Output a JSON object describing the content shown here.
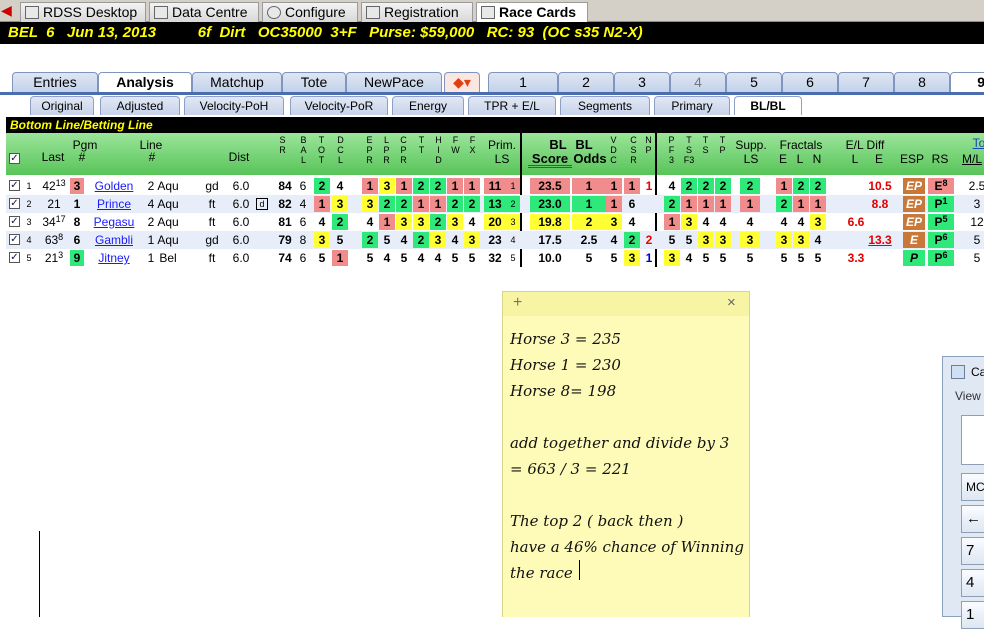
{
  "top_tabs": [
    {
      "label": "RDSS Desktop",
      "icon": "desktop-icon"
    },
    {
      "label": "Data Centre",
      "icon": "data-icon"
    },
    {
      "label": "Configure",
      "icon": "gear-icon"
    },
    {
      "label": "Registration",
      "icon": "registration-icon"
    },
    {
      "label": "Race Cards",
      "icon": "race-card-icon"
    }
  ],
  "race_info": "BEL  6   Jun 13, 2013          6f  Dirt   OC35000  3+F   Purse: $59,000   RC: 93  (OC s35 N2-X)",
  "nav_tabs": [
    "Entries",
    "Analysis",
    "Matchup",
    "Tote",
    "NewPace"
  ],
  "race_numbers": [
    "1",
    "2",
    "3",
    "4",
    "5",
    "6",
    "7",
    "8",
    "9"
  ],
  "sub_tabs": [
    "Original",
    "Adjusted",
    "Velocity-PoH",
    "Velocity-PoR",
    "Energy",
    "TPR + E/L",
    "Segments",
    "Primary",
    "BL/BL"
  ],
  "section_title": "Bottom Line/Betting Line",
  "headers": {
    "last": "Last",
    "pgm": "Pgm",
    "pgm_hash": "#",
    "line": "Line",
    "line_hash": "#",
    "dist": "Dist",
    "sr": "S\nR",
    "bal": "B\nA\nL",
    "tot": "T\nO\nT",
    "dcl": "D\nC\nL",
    "epr": "E\nP\nR",
    "lpr": "L\nP\nR",
    "cpr": "C\nP\nR",
    "tt": "T\nT",
    "hid": "H\nI\nD",
    "fw": "F\nW",
    "fx": "F\nX",
    "prim": "Prim.",
    "ls": "LS",
    "bl": "BL",
    "bl2": "BL",
    "score": "Score",
    "odds": "Odds",
    "vdc": "V\nD\nC",
    "csr": "C\nS\nR",
    "np": "N\nP",
    "pf3": "P\nF\n3",
    "tf3": "T\nS\nF3",
    "ts": "T\nS",
    "tp": "T\nP",
    "supp": "Supp.",
    "supp_ls": "LS",
    "fractals": "Fractals",
    "fe": "E",
    "fl": "L",
    "fn": "N",
    "eldiff": "E/L Diff",
    "el_l": "L",
    "el_e": "E",
    "esp": "ESP",
    "rs": "RS",
    "ml": "M/L",
    "to": "To"
  },
  "rows": [
    {
      "n": "1",
      "last": "42",
      "last_sup": "13",
      "pgm": "3",
      "name": "Golden",
      "line": "2",
      "trk": "Aqu",
      "cond": "gd",
      "dist": "6.0",
      "dflag": "",
      "sr": "84",
      "bal": "6",
      "tot": "2",
      "dcl": "4",
      "epr": "1",
      "lpr": "3",
      "cpr": "1",
      "tt": "2",
      "hid": "2",
      "fw": "1",
      "fx": "1",
      "prim": "11",
      "prim_rank": "1",
      "bl": "23.5",
      "blrank": "1",
      "odds": "",
      "vdc": "1",
      "csr": "1",
      "np": "1",
      "pf3": "4",
      "tf3": "2",
      "ts": "2",
      "tp": "2",
      "supp": "2",
      "fe": "1",
      "fl": "2",
      "fn": "2",
      "el_l": "",
      "el_e": "10.5",
      "esp": "EP",
      "rs": "E",
      "rs_sup": "8",
      "ml": "2.5"
    },
    {
      "n": "2",
      "last": "21",
      "last_sup": "",
      "pgm": "1",
      "name": "Prince",
      "line": "4",
      "trk": "Aqu",
      "cond": "ft",
      "dist": "6.0",
      "dflag": "d",
      "sr": "82",
      "bal": "4",
      "tot": "1",
      "dcl": "3",
      "epr": "3",
      "lpr": "2",
      "cpr": "2",
      "tt": "1",
      "hid": "1",
      "fw": "2",
      "fx": "2",
      "prim": "13",
      "prim_rank": "2",
      "bl": "23.0",
      "blrank": "1",
      "odds": "",
      "vdc": "1",
      "csr": "6",
      "np": "",
      "pf3": "2",
      "tf3": "1",
      "ts": "1",
      "tp": "1",
      "supp": "1",
      "fe": "2",
      "fl": "1",
      "fn": "1",
      "el_l": "",
      "el_e": "8.8",
      "esp": "EP",
      "rs": "P",
      "rs_sup": "1",
      "ml": "3"
    },
    {
      "n": "3",
      "last": "34",
      "last_sup": "17",
      "pgm": "8",
      "name": "Pegasu",
      "line": "2",
      "trk": "Aqu",
      "cond": "ft",
      "dist": "6.0",
      "dflag": "",
      "sr": "81",
      "bal": "6",
      "tot": "4",
      "dcl": "2",
      "epr": "4",
      "lpr": "1",
      "cpr": "3",
      "tt": "3",
      "hid": "2",
      "fw": "3",
      "fx": "4",
      "prim": "20",
      "prim_rank": "3",
      "bl": "19.8",
      "blrank": "2",
      "odds": "",
      "vdc": "3",
      "csr": "4",
      "np": "",
      "pf3": "1",
      "tf3": "3",
      "ts": "4",
      "tp": "4",
      "supp": "4",
      "fe": "4",
      "fl": "4",
      "fn": "3",
      "el_l": "6.6",
      "el_e": "",
      "esp": "EP",
      "rs": "P",
      "rs_sup": "5",
      "ml": "12"
    },
    {
      "n": "4",
      "last": "63",
      "last_sup": "8",
      "pgm": "6",
      "name": "Gambli",
      "line": "1",
      "trk": "Aqu",
      "cond": "gd",
      "dist": "6.0",
      "dflag": "",
      "sr": "79",
      "bal": "8",
      "tot": "3",
      "dcl": "5",
      "epr": "2",
      "lpr": "5",
      "cpr": "4",
      "tt": "2",
      "hid": "3",
      "fw": "4",
      "fx": "3",
      "prim": "23",
      "prim_rank": "4",
      "bl": "17.5",
      "blrank": "",
      "odds": "2.5",
      "vdc": "4",
      "csr": "2",
      "np": "2",
      "pf3": "5",
      "tf3": "5",
      "ts": "3",
      "tp": "3",
      "supp": "3",
      "fe": "3",
      "fl": "3",
      "fn": "4",
      "el_l": "",
      "el_e": "13.3",
      "esp": "E",
      "rs": "P",
      "rs_sup": "6",
      "ml": "5"
    },
    {
      "n": "5",
      "last": "21",
      "last_sup": "3",
      "pgm": "9",
      "name": "Jitney",
      "line": "1",
      "trk": "Bel",
      "cond": "ft",
      "dist": "6.0",
      "dflag": "",
      "sr": "74",
      "bal": "6",
      "tot": "5",
      "dcl": "1",
      "epr": "5",
      "lpr": "4",
      "cpr": "5",
      "tt": "4",
      "hid": "4",
      "fw": "5",
      "fx": "5",
      "prim": "32",
      "prim_rank": "5",
      "bl": "10.0",
      "blrank": "",
      "odds": "5",
      "vdc": "5",
      "csr": "3",
      "np": "1",
      "pf3": "3",
      "tf3": "4",
      "ts": "5",
      "tp": "5",
      "supp": "5",
      "fe": "5",
      "fl": "5",
      "fn": "5",
      "el_l": "3.3",
      "el_e": "",
      "esp": "P",
      "rs": "P",
      "rs_sup": "6",
      "ml": "5"
    }
  ],
  "note": {
    "plus": "+",
    "close": "×",
    "text": "Horse 3 = 235\nHorse 1 = 230\nHorse 8= 198\n\nadd together and divide by 3\n= 663 / 3 = 221\n\nThe top 2 ( back then )\nhave a 46% chance of Winning\nthe race"
  },
  "calculator": {
    "title": "Ca",
    "menu": "View",
    "buttons": [
      "MC",
      "←",
      "7",
      "4",
      "1"
    ]
  }
}
